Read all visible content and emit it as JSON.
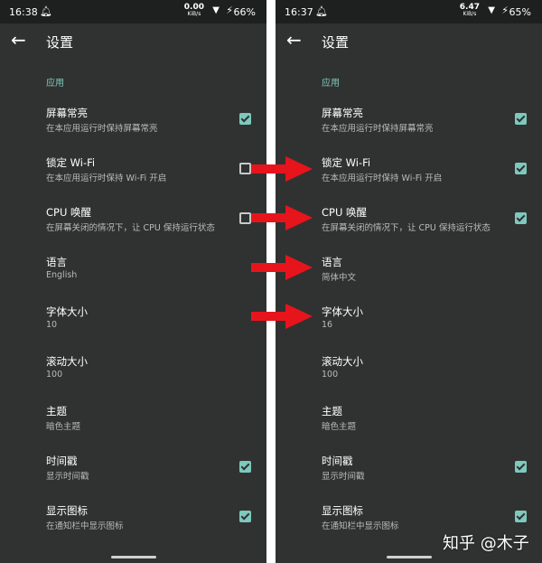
{
  "left": {
    "status": {
      "time": "16:38",
      "net_speed": "0.00",
      "net_unit": "KiB/s",
      "battery": "66%"
    },
    "title": "设置",
    "section": "应用",
    "prefs": [
      {
        "title": "屏幕常亮",
        "summary": "在本应用运行时保持屏幕常亮",
        "checked": true
      },
      {
        "title": "锁定 Wi-Fi",
        "summary": "在本应用运行时保持 Wi-Fi 开启",
        "checked": false
      },
      {
        "title": "CPU 唤醒",
        "summary": "在屏幕关闭的情况下，让 CPU 保持运行状态",
        "checked": false
      },
      {
        "title": "语言",
        "summary": "English"
      },
      {
        "title": "字体大小",
        "summary": "10"
      },
      {
        "title": "滚动大小",
        "summary": "100"
      },
      {
        "title": "主题",
        "summary": "暗色主题"
      },
      {
        "title": "时间戳",
        "summary": "显示时间戳",
        "checked": true
      },
      {
        "title": "显示图标",
        "summary": "在通知栏中显示图标",
        "checked": true
      }
    ]
  },
  "right": {
    "status": {
      "time": "16:37",
      "net_speed": "6.47",
      "net_unit": "KiB/s",
      "battery": "65%"
    },
    "title": "设置",
    "section": "应用",
    "prefs": [
      {
        "title": "屏幕常亮",
        "summary": "在本应用运行时保持屏幕常亮",
        "checked": true
      },
      {
        "title": "锁定 Wi-Fi",
        "summary": "在本应用运行时保持 Wi-Fi 开启",
        "checked": true
      },
      {
        "title": "CPU 唤醒",
        "summary": "在屏幕关闭的情况下，让 CPU 保持运行状态",
        "checked": true
      },
      {
        "title": "语言",
        "summary": "简体中文"
      },
      {
        "title": "字体大小",
        "summary": "16"
      },
      {
        "title": "滚动大小",
        "summary": "100"
      },
      {
        "title": "主题",
        "summary": "暗色主题"
      },
      {
        "title": "时间戳",
        "summary": "显示时间戳",
        "checked": true
      },
      {
        "title": "显示图标",
        "summary": "在通知栏中显示图标",
        "checked": true
      }
    ]
  },
  "watermark": "知乎 @木子",
  "colors": {
    "background": "#303231",
    "accent": "#7ec9bd",
    "arrow": "#e8141c"
  }
}
